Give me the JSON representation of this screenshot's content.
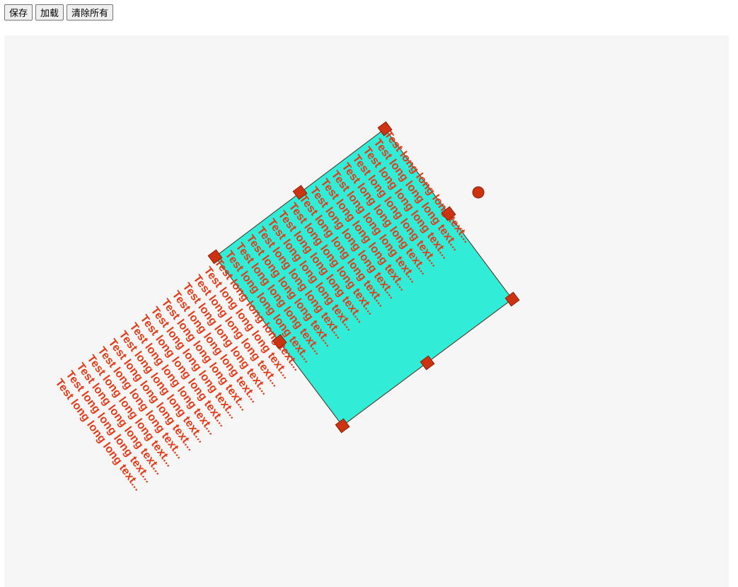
{
  "toolbar": {
    "save_label": "保存",
    "load_label": "加载",
    "clear_label": "清除所有"
  },
  "canvas": {
    "background": "#f6f6f6",
    "textbox": {
      "fill": "#31ecd6",
      "text_color": "#e33b17",
      "handle_color": "#cc3311",
      "line_text": "Test long long long text..."
    }
  }
}
